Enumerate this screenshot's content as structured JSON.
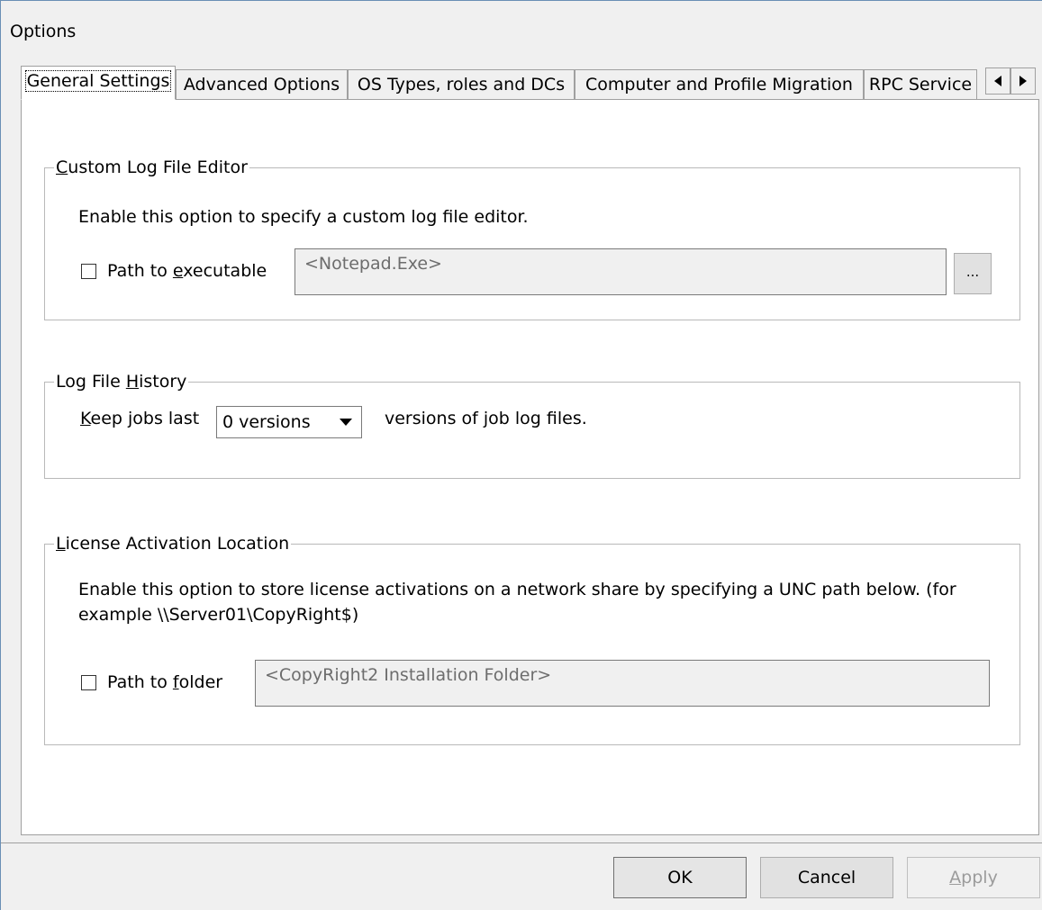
{
  "window": {
    "title": "Options"
  },
  "tabs": [
    {
      "label": "General Settings",
      "active": true
    },
    {
      "label": "Advanced Options",
      "active": false
    },
    {
      "label": "OS Types, roles and DCs",
      "active": false
    },
    {
      "label": "Computer and Profile Migration",
      "active": false
    },
    {
      "label": "RPC Service",
      "active": false
    }
  ],
  "tab_scroll": {
    "left_icon": "triangle-left-icon",
    "right_icon": "triangle-right-icon"
  },
  "custom_log_editor": {
    "legend_prefix": "",
    "legend_accel": "C",
    "legend_rest": "ustom Log File Editor",
    "description": "Enable this option to specify a custom log file editor.",
    "checkbox_prefix": "Path to ",
    "checkbox_accel": "e",
    "checkbox_rest": "xecutable",
    "checked": false,
    "path_value": "<Notepad.Exe>",
    "browse_label": "..."
  },
  "log_history": {
    "legend_prefix": "Log File ",
    "legend_accel": "H",
    "legend_rest": "istory",
    "label_accel": "K",
    "label_rest": "eep jobs last",
    "selected": "0 versions",
    "suffix": "versions of job log files."
  },
  "license_location": {
    "legend_prefix": "",
    "legend_accel": "L",
    "legend_rest": "icense Activation Location",
    "description": "Enable this option to store license activations on a network share by specifying a UNC path below. (for example \\\\Server01\\CopyRight$)",
    "checkbox_prefix": "Path to ",
    "checkbox_accel": "f",
    "checkbox_rest": "older",
    "checked": false,
    "path_value": "<CopyRight2 Installation Folder>"
  },
  "buttons": {
    "ok": "OK",
    "cancel": "Cancel",
    "apply_accel": "A",
    "apply_rest": "pply"
  },
  "colors": {
    "panel": "#ffffff",
    "window": "#f0f0f0",
    "border": "#a0a0a0"
  }
}
